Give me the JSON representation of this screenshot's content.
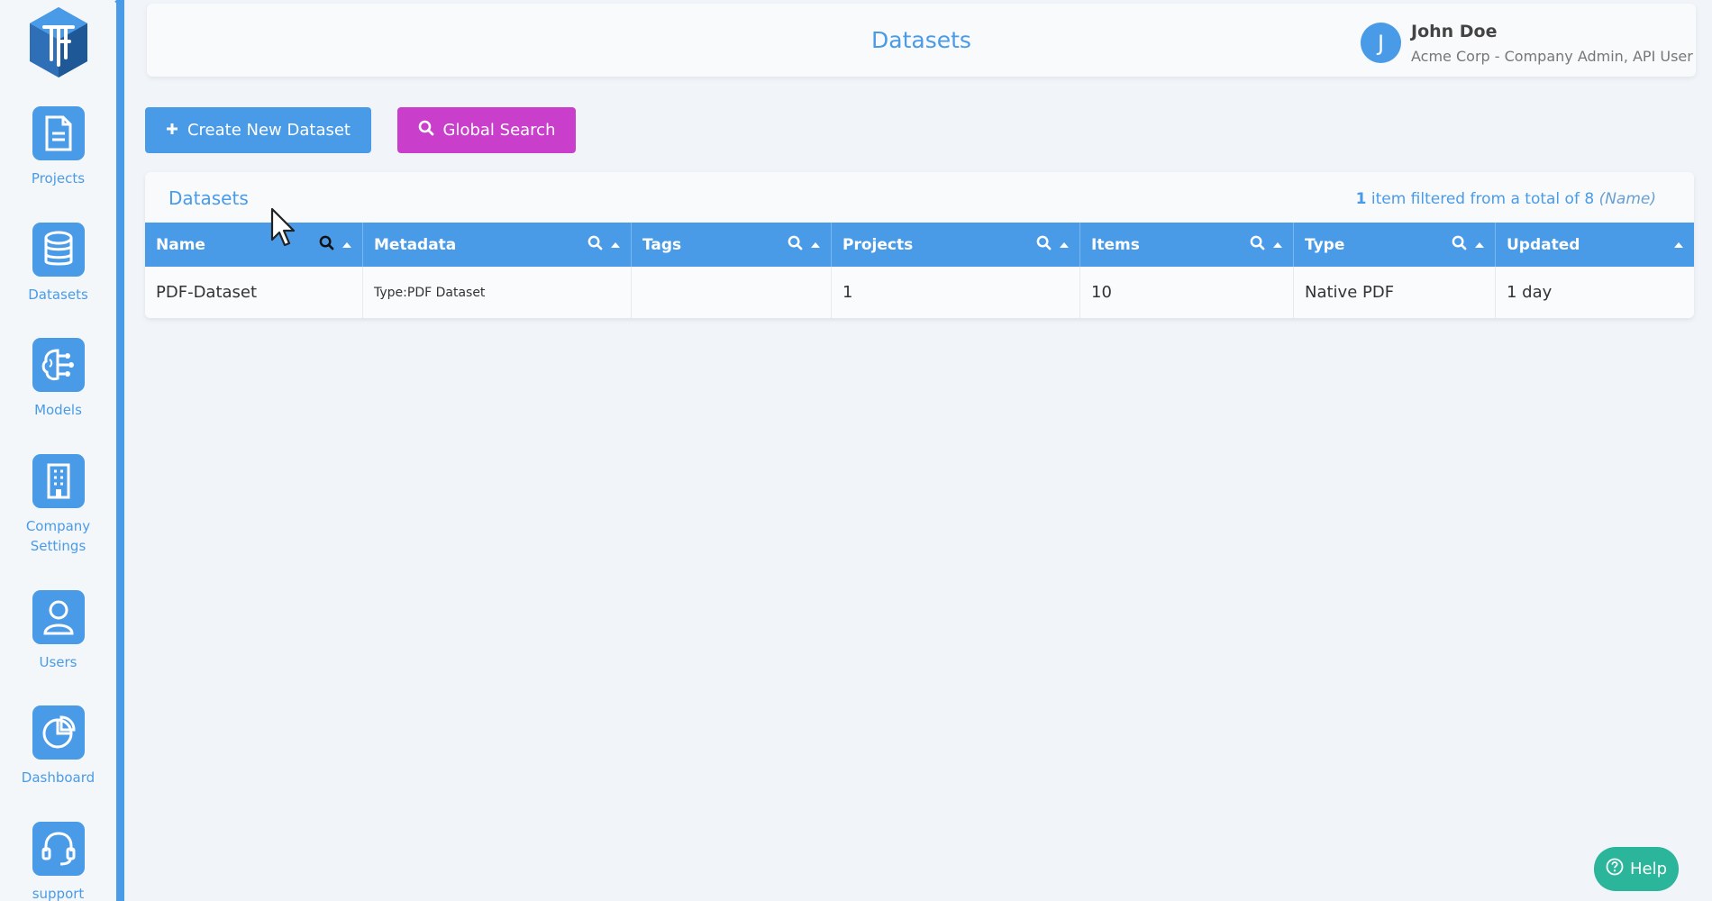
{
  "sidebar": {
    "items": [
      {
        "label": "Projects",
        "icon": "document-icon"
      },
      {
        "label": "Datasets",
        "icon": "database-icon"
      },
      {
        "label": "Models",
        "icon": "brain-icon"
      },
      {
        "label": "Company\nSettings",
        "icon": "building-icon"
      },
      {
        "label": "Users",
        "icon": "user-icon"
      },
      {
        "label": "Dashboard",
        "icon": "pie-chart-icon"
      },
      {
        "label": "support",
        "icon": "headset-icon"
      }
    ]
  },
  "header": {
    "title": "Datasets",
    "user": {
      "initial": "J",
      "name": "John Doe",
      "role": "Acme Corp - Company Admin, API User"
    }
  },
  "toolbar": {
    "create_label": "Create New Dataset",
    "search_label": "Global Search"
  },
  "datasets_card": {
    "title": "Datasets",
    "filter_count": "1",
    "filter_text": " item filtered from a total of 8 ",
    "filter_field": "(Name)"
  },
  "table": {
    "columns": [
      "Name",
      "Metadata",
      "Tags",
      "Projects",
      "Items",
      "Type",
      "Updated"
    ],
    "rows": [
      {
        "name": "PDF-Dataset",
        "metadata": "Type:PDF Dataset",
        "tags": "",
        "projects": "1",
        "items": "10",
        "type": "Native PDF",
        "updated": "1 day"
      }
    ]
  },
  "help": {
    "label": "Help"
  },
  "colors": {
    "accent": "#4a9be7",
    "global_search": "#c93fcb",
    "help": "#2bb59a"
  }
}
